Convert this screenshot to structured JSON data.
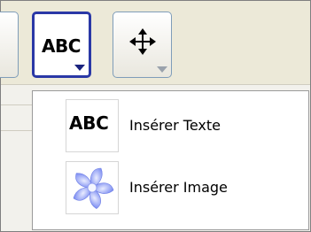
{
  "toolbar": {
    "text_button_label": "ABC",
    "text_button_icon": "abc-text-icon",
    "move_button_icon": "four-arrow-move-icon",
    "dropdown_icon": "dropdown-caret-icon",
    "selected_border_color": "#2a38a6"
  },
  "menu": {
    "items": [
      {
        "icon": "abc-text-icon",
        "icon_text": "ABC",
        "label": "Insérer Texte"
      },
      {
        "icon": "flower-image-icon",
        "label": "Insérer Image"
      }
    ]
  }
}
